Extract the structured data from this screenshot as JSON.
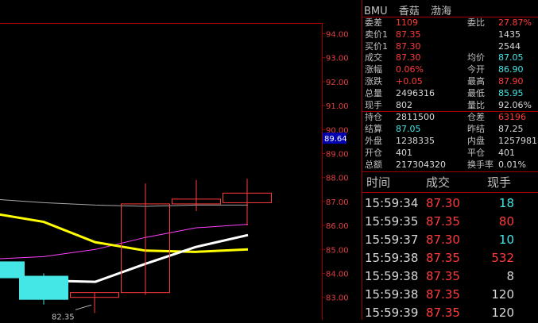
{
  "header": {
    "code": "BMU",
    "name": "香菇",
    "exchange": "渤海"
  },
  "quote_rows": [
    {
      "l1": "委差",
      "v1": "1109",
      "v1c": "red",
      "l2": "委比",
      "v2": "27.87%",
      "v2c": "red"
    },
    {
      "l1": "卖价1",
      "v1": "87.35",
      "v1c": "red",
      "l2": "",
      "v2": "1435",
      "v2c": "white"
    },
    {
      "l1": "买价1",
      "v1": "87.30",
      "v1c": "red",
      "l2": "",
      "v2": "2544",
      "v2c": "white"
    },
    {
      "l1": "成交",
      "v1": "87.30",
      "v1c": "red",
      "l2": "均价",
      "v2": "87.05",
      "v2c": "cyan"
    },
    {
      "l1": "涨幅",
      "v1": "0.06%",
      "v1c": "red",
      "l2": "今开",
      "v2": "86.90",
      "v2c": "cyan"
    },
    {
      "l1": "涨跌",
      "v1": "+0.05",
      "v1c": "red",
      "l2": "最高",
      "v2": "87.90",
      "v2c": "red"
    },
    {
      "l1": "总量",
      "v1": "2496316",
      "v1c": "white",
      "l2": "最低",
      "v2": "85.95",
      "v2c": "cyan"
    },
    {
      "l1": "现手",
      "v1": "802",
      "v1c": "white",
      "l2": "量比",
      "v2": "92.06%",
      "v2c": "white"
    },
    {
      "l1": "持仓",
      "v1": "2811500",
      "v1c": "white",
      "l2": "仓差",
      "v2": "63196",
      "v2c": "red"
    },
    {
      "l1": "结算",
      "v1": "87.05",
      "v1c": "cyan",
      "l2": "昨结",
      "v2": "87.25",
      "v2c": "white"
    },
    {
      "l1": "外盘",
      "v1": "1238335",
      "v1c": "white",
      "l2": "内盘",
      "v2": "1257981",
      "v2c": "white"
    },
    {
      "l1": "开仓",
      "v1": "401",
      "v1c": "white",
      "l2": "平仓",
      "v2": "401",
      "v2c": "white"
    },
    {
      "l1": "总额",
      "v1": "217304320",
      "v1c": "white",
      "l2": "换手率",
      "v2": "0.01%",
      "v2c": "white"
    }
  ],
  "ticks": {
    "headers": [
      "时间",
      "成交",
      "现手"
    ],
    "rows": [
      {
        "time": "15:59:34",
        "price": "87.30",
        "qty": "18",
        "qc": "cyan"
      },
      {
        "time": "15:59:35",
        "price": "87.35",
        "qty": "80",
        "qc": "red"
      },
      {
        "time": "15:59:37",
        "price": "87.30",
        "qty": "10",
        "qc": "cyan"
      },
      {
        "time": "15:59:38",
        "price": "87.35",
        "qty": "532",
        "qc": "red"
      },
      {
        "time": "15:59:38",
        "price": "87.35",
        "qty": "8",
        "qc": "white"
      },
      {
        "time": "15:59:38",
        "price": "87.35",
        "qty": "120",
        "qc": "white"
      },
      {
        "time": "15:59:39",
        "price": "87.35",
        "qty": "120",
        "qc": "white"
      }
    ]
  },
  "colors": {
    "up": "#ff3b3b",
    "down": "#45e6e6",
    "ma_white": "#ffffff",
    "ma_yellow": "#ffff00",
    "ma_magenta": "#ff40ff",
    "ma_gray": "#a8a8a8",
    "grid": "#a00000"
  },
  "chart_data": {
    "type": "candlestick",
    "y_ticks": [
      "94.00",
      "93.00",
      "92.00",
      "91.00",
      "90.00",
      "89.00",
      "88.00",
      "87.00",
      "86.00",
      "85.00",
      "84.00",
      "83.00"
    ],
    "ylim": [
      82.3,
      94.5
    ],
    "current_price_label": "89.64",
    "min_label": "82.35",
    "candles": [
      {
        "o": 84.5,
        "h": 84.5,
        "l": 83.8,
        "c": 83.8
      },
      {
        "o": 83.9,
        "h": 84.0,
        "l": 82.7,
        "c": 82.9
      },
      {
        "o": 83.0,
        "h": 83.2,
        "l": 82.35,
        "c": 83.2
      },
      {
        "o": 83.2,
        "h": 87.75,
        "l": 83.1,
        "c": 86.9
      },
      {
        "o": 86.9,
        "h": 87.9,
        "l": 86.6,
        "c": 87.1
      },
      {
        "o": 86.95,
        "h": 87.95,
        "l": 86.0,
        "c": 87.35
      }
    ],
    "ma_white": [
      83.7,
      83.65,
      84.4,
      85.1,
      85.6
    ],
    "ma_yellow": [
      86.5,
      86.15,
      85.3,
      84.95,
      84.9,
      85.0
    ],
    "ma_magenta": [
      84.6,
      84.7,
      85.0,
      85.5,
      85.9,
      86.05
    ],
    "ma_gray": [
      87.1,
      86.95,
      86.85,
      86.8,
      86.85,
      86.85
    ]
  }
}
